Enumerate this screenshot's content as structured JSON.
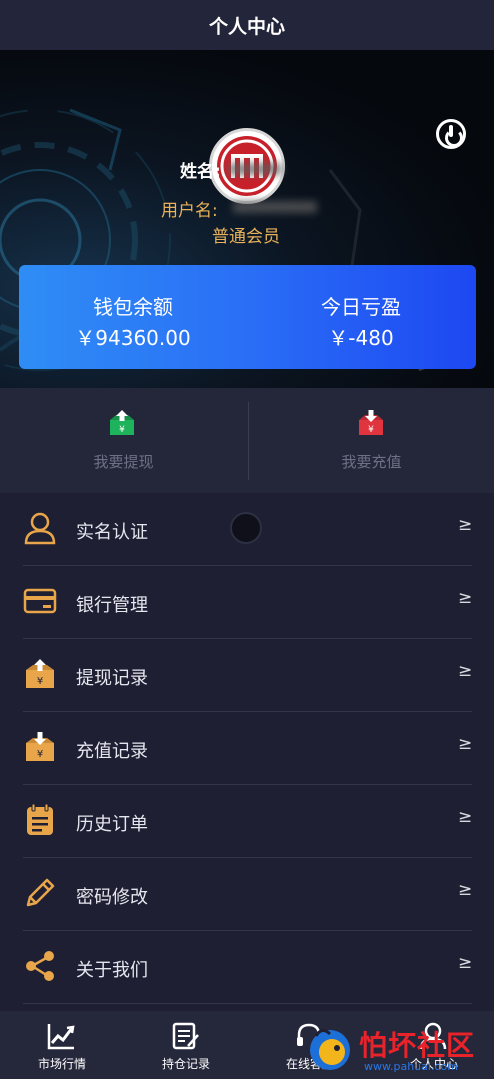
{
  "header": {
    "title": "个人中心"
  },
  "profile": {
    "name_label": "姓名:",
    "username_label": "用户名:",
    "level": "普通会员"
  },
  "wallet": {
    "balance_label": "钱包余额",
    "balance_value": "￥94360.00",
    "pnl_label": "今日亏盈",
    "pnl_value": "￥-480"
  },
  "actions": {
    "withdraw": "我要提现",
    "recharge": "我要充值"
  },
  "menu": {
    "items": [
      {
        "label": "实名认证",
        "arrow": "≥"
      },
      {
        "label": "银行管理",
        "arrow": "≥"
      },
      {
        "label": "提现记录",
        "arrow": "≥"
      },
      {
        "label": "充值记录",
        "arrow": "≥"
      },
      {
        "label": "历史订单",
        "arrow": "≥"
      },
      {
        "label": "密码修改",
        "arrow": "≥"
      },
      {
        "label": "关于我们",
        "arrow": "≥"
      }
    ]
  },
  "tabbar": {
    "items": [
      {
        "label": "市场行情"
      },
      {
        "label": "持仓记录"
      },
      {
        "label": "在线客服"
      },
      {
        "label": "个人中心"
      }
    ]
  },
  "watermark": {
    "text": "怕坏社区",
    "url": "www.pahuai.com"
  },
  "colors": {
    "accent_gold": "#e9b25a",
    "withdraw_green": "#1fb25c",
    "recharge_red": "#e0343f",
    "wallet_gradient_start": "#2f8df5",
    "wallet_gradient_end": "#1d48f2"
  }
}
